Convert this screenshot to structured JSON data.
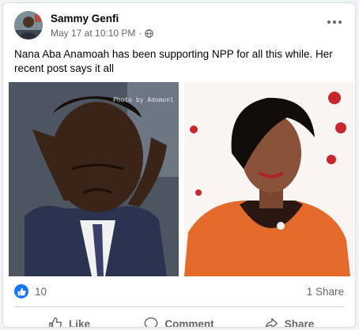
{
  "post": {
    "author": "Sammy Genfi",
    "date": "May 17 at 10:10 PM",
    "separator": "·",
    "privacy_icon": "globe-icon",
    "text": "Nana Aba Anamoah has been supporting NPP for all this while. Her recent post says it all",
    "image_watermark": "Photo by Adomonl"
  },
  "stats": {
    "likes": "10",
    "shares": "1 Share"
  },
  "actions": {
    "like": "Like",
    "comment": "Comment",
    "share": "Share"
  },
  "colors": {
    "accent": "#1877f2",
    "secondary_text": "#65676b",
    "primary_text": "#050505"
  }
}
